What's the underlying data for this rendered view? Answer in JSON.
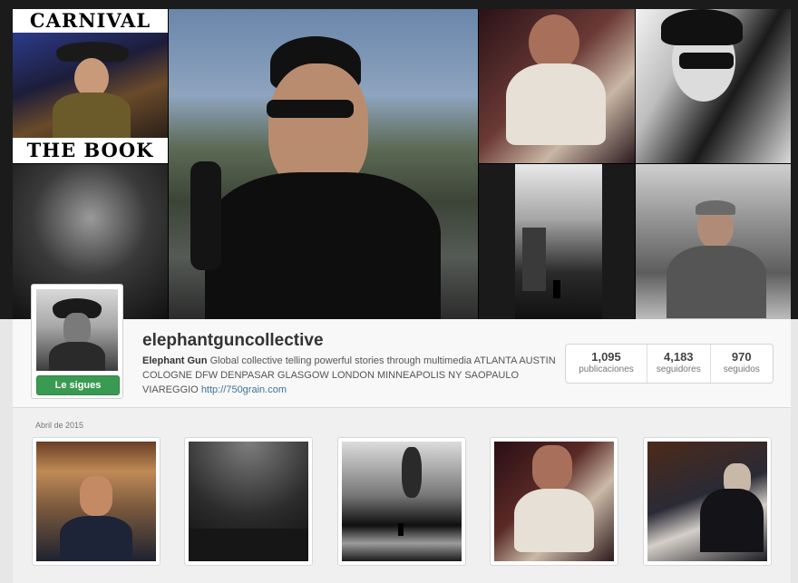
{
  "header_mosaic": {
    "carnival_top": "CARNIVAL",
    "carnival_bottom": "THE BOOK"
  },
  "profile": {
    "username": "elephantguncollective",
    "display_name": "Elephant Gun",
    "bio": "Global collective telling powerful stories through multimedia ATLANTA AUSTIN COLOGNE DFW DENPASAR GLASGOW LONDON MINNEAPOLIS NY SAOPAULO VIAREGGIO",
    "website": "http://750grain.com",
    "follow_label": "Le sigues",
    "follow_color": "#3a9a52"
  },
  "stats": [
    {
      "value": "1,095",
      "label": "publicaciones"
    },
    {
      "value": "4,183",
      "label": "seguidores"
    },
    {
      "value": "970",
      "label": "seguidos"
    }
  ],
  "feed": {
    "date_label": "Abril de 2015",
    "thumbs": [
      "bartender-photo",
      "dome-photo",
      "smoke-road-photo",
      "old-man-photo",
      "seated-man-photo"
    ]
  }
}
